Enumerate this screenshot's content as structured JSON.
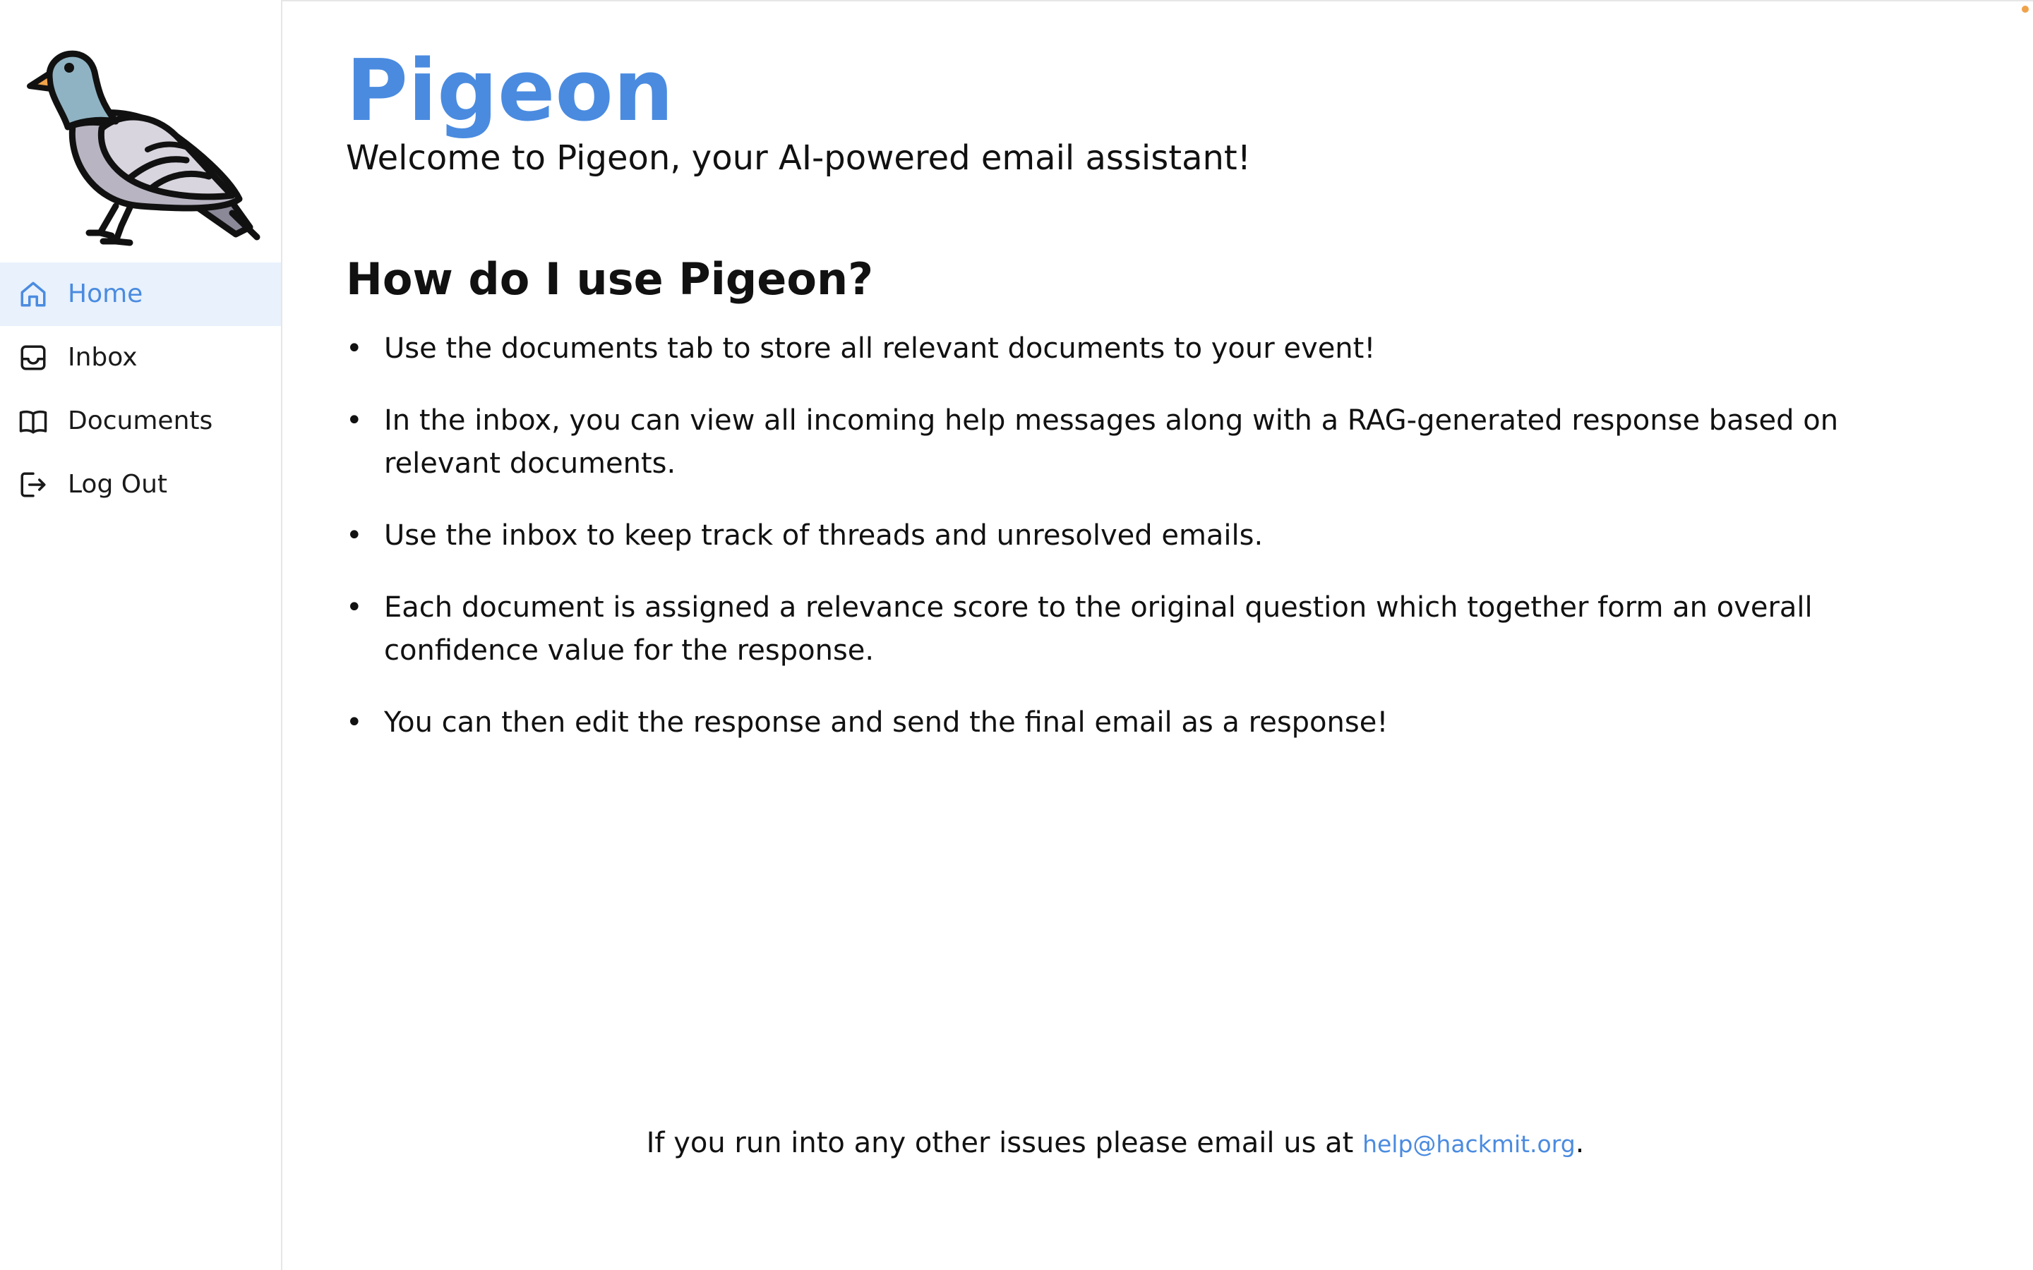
{
  "sidebar": {
    "logo_icon": "pigeon-logo-icon",
    "items": [
      {
        "label": "Home",
        "icon": "home-icon",
        "active": true
      },
      {
        "label": "Inbox",
        "icon": "inbox-icon",
        "active": false
      },
      {
        "label": "Documents",
        "icon": "book-icon",
        "active": false
      },
      {
        "label": "Log Out",
        "icon": "logout-icon",
        "active": false
      }
    ]
  },
  "main": {
    "title": "Pigeon",
    "subtitle": "Welcome to Pigeon, your AI-powered email assistant!",
    "section_heading": "How do I use Pigeon?",
    "steps": [
      "Use the documents tab to store all relevant documents to your event!",
      "In the inbox, you can view all incoming help messages along with a RAG-generated response based on relevant documents.",
      "Use the inbox to keep track of threads and unresolved emails.",
      "Each document is assigned a relevance score to the original question which together form an overall confidence value for the response.",
      "You can then edit the response and send the final email as a response!"
    ],
    "bullet": "•",
    "footer": {
      "text": "If you run into any other issues please email us at ",
      "email": "help@hackmit.org",
      "suffix": "."
    }
  },
  "colors": {
    "accent": "#4a8be0",
    "active_bg": "#e8f1fc",
    "border": "#e6e6e6",
    "text": "#111111"
  }
}
